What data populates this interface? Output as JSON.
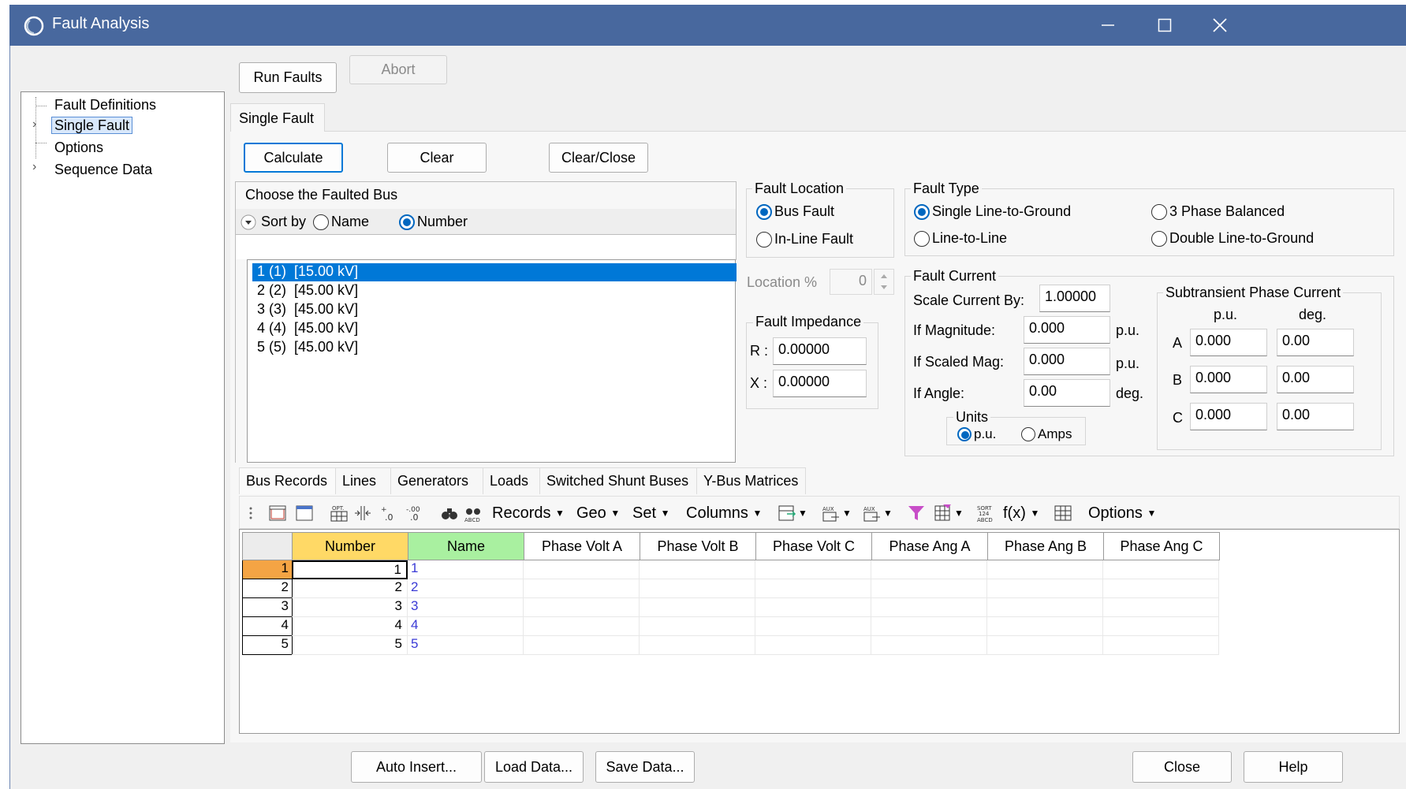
{
  "window": {
    "title": "Fault Analysis",
    "controls": [
      "minimize-icon",
      "maximize-icon",
      "close-icon"
    ]
  },
  "top_buttons": {
    "run_faults": "Run Faults",
    "abort": "Abort"
  },
  "tree": {
    "items": [
      {
        "label": "Fault Definitions",
        "expandable": false,
        "selected": false
      },
      {
        "label": "Single Fault",
        "expandable": true,
        "selected": true
      },
      {
        "label": "Options",
        "expandable": false,
        "selected": false
      },
      {
        "label": "Sequence Data",
        "expandable": true,
        "selected": false
      }
    ]
  },
  "main_tab": "Single Fault",
  "action_buttons": {
    "calculate": "Calculate",
    "clear": "Clear",
    "clear_close": "Clear/Close"
  },
  "bus_chooser": {
    "header": "Choose the Faulted Bus",
    "sort_by": "Sort by",
    "sort_name": "Name",
    "sort_number": "Number",
    "sort_selected": "Number",
    "filter_value": "",
    "buses": [
      "1 (1)  [15.00 kV]",
      "2 (2)  [45.00 kV]",
      "3 (3)  [45.00 kV]",
      "4 (4)  [45.00 kV]",
      "5 (5)  [45.00 kV]"
    ],
    "selected_index": 0
  },
  "fault_location": {
    "title": "Fault Location",
    "bus_fault": "Bus Fault",
    "inline_fault": "In-Line Fault",
    "selected": "Bus Fault",
    "location_label": "Location %",
    "location_value": "0"
  },
  "fault_impedance": {
    "title": "Fault Impedance",
    "r_label": "R :",
    "r_value": "0.00000",
    "x_label": "X :",
    "x_value": "0.00000"
  },
  "fault_type": {
    "title": "Fault Type",
    "options": [
      "Single Line-to-Ground",
      "3 Phase Balanced",
      "Line-to-Line",
      "Double Line-to-Ground"
    ],
    "selected": "Single Line-to-Ground"
  },
  "fault_current": {
    "title": "Fault Current",
    "scale_label": "Scale Current By:",
    "scale_value": "1.00000",
    "mag_label": "If Magnitude:",
    "mag_value": "0.000",
    "mag_unit": "p.u.",
    "scaled_label": "If Scaled Mag:",
    "scaled_value": "0.000",
    "scaled_unit": "p.u.",
    "angle_label": "If Angle:",
    "angle_value": "0.00",
    "angle_unit": "deg.",
    "units_title": "Units",
    "unit_pu": "p.u.",
    "unit_amps": "Amps",
    "unit_selected": "p.u."
  },
  "subtransient": {
    "title": "Subtransient Phase Current",
    "col_pu": "p.u.",
    "col_deg": "deg.",
    "rows": [
      {
        "phase": "A",
        "pu": "0.000",
        "deg": "0.00"
      },
      {
        "phase": "B",
        "pu": "0.000",
        "deg": "0.00"
      },
      {
        "phase": "C",
        "pu": "0.000",
        "deg": "0.00"
      }
    ]
  },
  "bottom_tabs": [
    "Bus Records",
    "Lines",
    "Generators",
    "Loads",
    "Switched Shunt Buses",
    "Y-Bus Matrices"
  ],
  "active_bottom_tab": "Bus Records",
  "toolbar": {
    "records": "Records",
    "geo": "Geo",
    "set": "Set",
    "columns": "Columns",
    "fx": "f(x)",
    "options": "Options"
  },
  "grid": {
    "columns": [
      "Number",
      "Name",
      "Phase Volt A",
      "Phase Volt B",
      "Phase Volt C",
      "Phase Ang A",
      "Phase Ang B",
      "Phase Ang C"
    ],
    "rows": [
      {
        "row": "1",
        "number": "1",
        "name": "1"
      },
      {
        "row": "2",
        "number": "2",
        "name": "2"
      },
      {
        "row": "3",
        "number": "3",
        "name": "3"
      },
      {
        "row": "4",
        "number": "4",
        "name": "4"
      },
      {
        "row": "5",
        "number": "5",
        "name": "5"
      }
    ],
    "number_header_color": "#ffd966",
    "name_header_color": "#a9f0a0",
    "selected_row_color": "#f4a444"
  },
  "footer_buttons": {
    "auto_insert": "Auto Insert...",
    "load_data": "Load Data...",
    "save_data": "Save Data...",
    "close": "Close",
    "help": "Help"
  },
  "colors": {
    "titlebar": "#48689e",
    "selection": "#0078d7",
    "radio_on": "#0067c0"
  }
}
